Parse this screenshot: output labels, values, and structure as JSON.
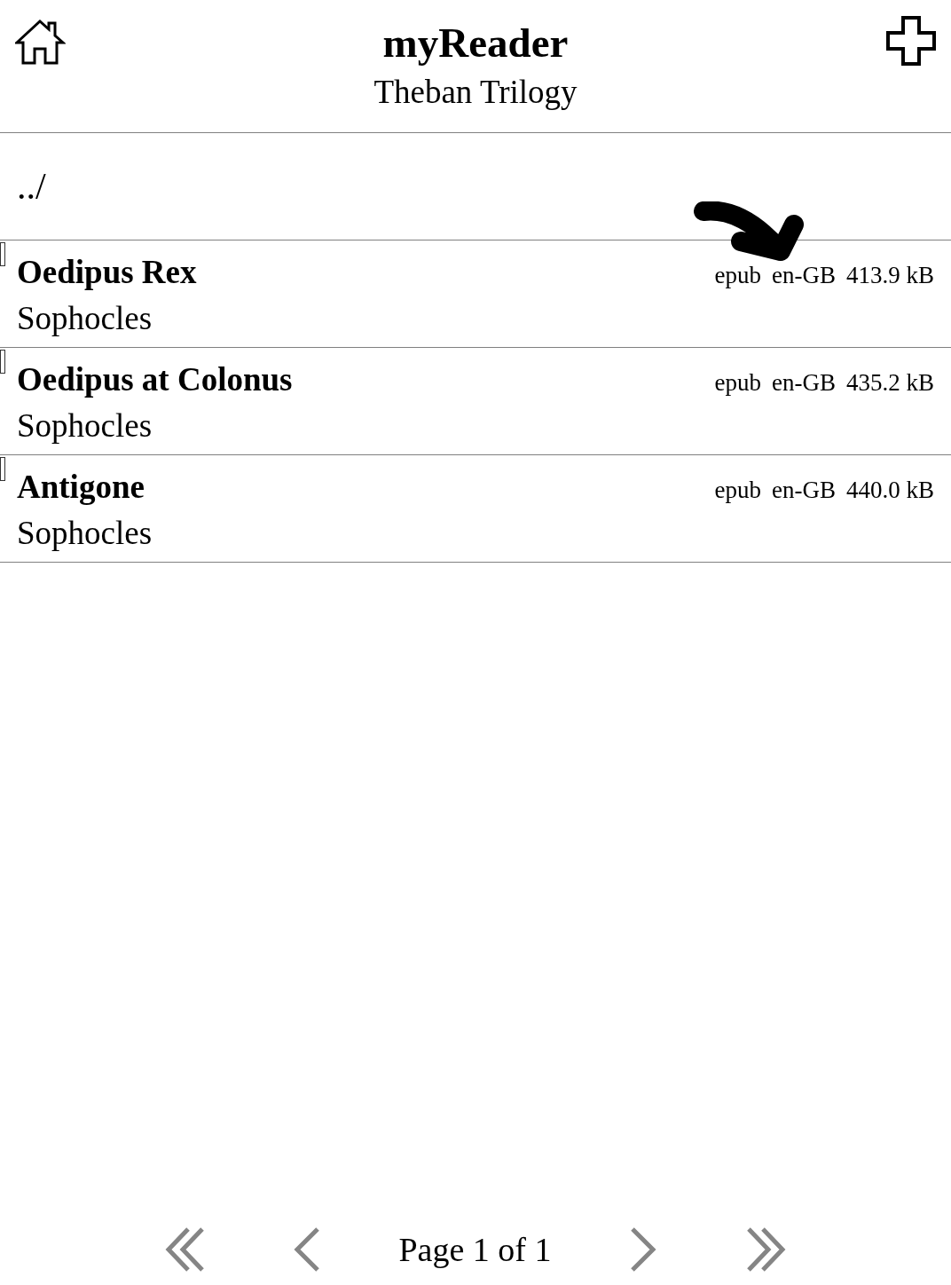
{
  "app_title": "myReader",
  "folder_title": "Theban Trilogy",
  "parent_link": "../",
  "books": [
    {
      "title": "Oedipus Rex",
      "author": "Sophocles",
      "format": "epub",
      "language": "en-GB",
      "size": "413.9 kB"
    },
    {
      "title": "Oedipus at Colonus",
      "author": "Sophocles",
      "format": "epub",
      "language": "en-GB",
      "size": "435.2 kB"
    },
    {
      "title": "Antigone",
      "author": "Sophocles",
      "format": "epub",
      "language": "en-GB",
      "size": "440.0 kB"
    }
  ],
  "pagination": {
    "label": "Page 1 of 1",
    "buttons": [
      {
        "kind": "first",
        "disabled": true
      },
      {
        "kind": "prev",
        "disabled": true
      },
      {
        "kind": "next",
        "disabled": true
      },
      {
        "kind": "last",
        "disabled": true
      }
    ]
  }
}
